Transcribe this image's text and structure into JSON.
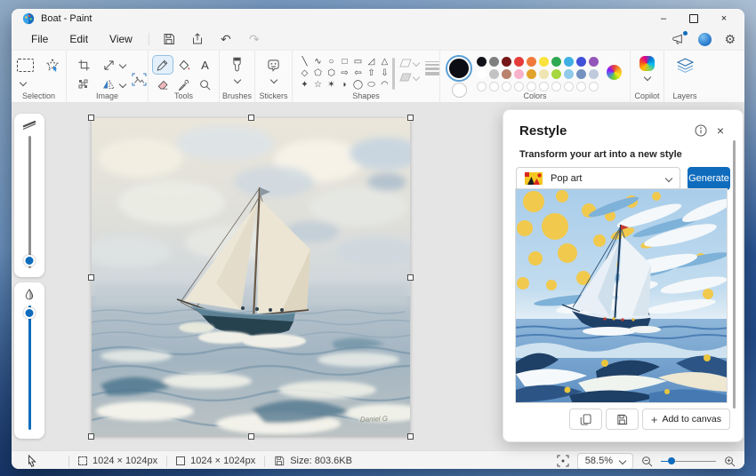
{
  "window": {
    "title": "Boat - Paint"
  },
  "menubar": {
    "items": [
      "File",
      "Edit",
      "View"
    ]
  },
  "icons": {
    "minimize": "–",
    "close_window": "×",
    "undo": "↶",
    "redo": "↷",
    "gear": "⚙",
    "text_tool": "A",
    "plus": "+"
  },
  "ribbon": {
    "groups": {
      "selection": "Selection",
      "image": "Image",
      "tools": "Tools",
      "brushes": "Brushes",
      "stickers": "Stickers",
      "shapes": "Shapes",
      "colors": "Colors",
      "copilot": "Copilot",
      "layers": "Layers"
    },
    "selected_tool": "pencil"
  },
  "shapes": {
    "items": [
      {
        "name": "line",
        "glyph": "╲"
      },
      {
        "name": "curve",
        "glyph": "∿"
      },
      {
        "name": "oval",
        "glyph": "○"
      },
      {
        "name": "rectangle",
        "glyph": "□"
      },
      {
        "name": "rounded-rectangle",
        "glyph": "▭"
      },
      {
        "name": "right-triangle",
        "glyph": "◿"
      },
      {
        "name": "triangle",
        "glyph": "△"
      },
      {
        "name": "diamond",
        "glyph": "◇"
      },
      {
        "name": "pentagon",
        "glyph": "⬠"
      },
      {
        "name": "hexagon",
        "glyph": "⬡"
      },
      {
        "name": "arrow-right",
        "glyph": "⇨"
      },
      {
        "name": "arrow-left",
        "glyph": "⇦"
      },
      {
        "name": "arrow-up",
        "glyph": "⇧"
      },
      {
        "name": "arrow-down",
        "glyph": "⇩"
      },
      {
        "name": "four-point-star",
        "glyph": "✦"
      },
      {
        "name": "five-point-star",
        "glyph": "☆"
      },
      {
        "name": "six-point-star",
        "glyph": "✶"
      },
      {
        "name": "rounded-balloon",
        "glyph": "◗"
      },
      {
        "name": "oval-balloon",
        "glyph": "◯"
      },
      {
        "name": "cloud-balloon",
        "glyph": "⬭"
      },
      {
        "name": "arc",
        "glyph": "◠"
      }
    ]
  },
  "colors": {
    "accent": "#0f6cbd",
    "selected_color": "#0c0c15",
    "secondary_color": "#ffffff",
    "palette_row1": [
      "#101018",
      "#7f7f7f",
      "#771618",
      "#e43b3b",
      "#f17a3a",
      "#f9e33c",
      "#2fa852",
      "#3fafe4",
      "#4150d8",
      "#9356b8"
    ],
    "palette_row2": [
      "#ffffff",
      "#c3c3c3",
      "#b8826c",
      "#f7b1ca",
      "#e2a32b",
      "#efe5b2",
      "#a6d640",
      "#90c9e9",
      "#7392bf",
      "#bfcbdd"
    ],
    "empty_count": 10
  },
  "restyle": {
    "title": "Restyle",
    "subtitle": "Transform your art into a new style",
    "style_name": "Pop art",
    "generate_label": "Generate",
    "add_to_canvas_label": "Add to canvas"
  },
  "canvas_painting": {
    "signature": "Daniel G"
  },
  "statusbar": {
    "selection_size": "1024 × 1024px",
    "image_size": "1024 × 1024px",
    "file_size": "Size: 803.6KB",
    "zoom_level": "58.5%"
  }
}
